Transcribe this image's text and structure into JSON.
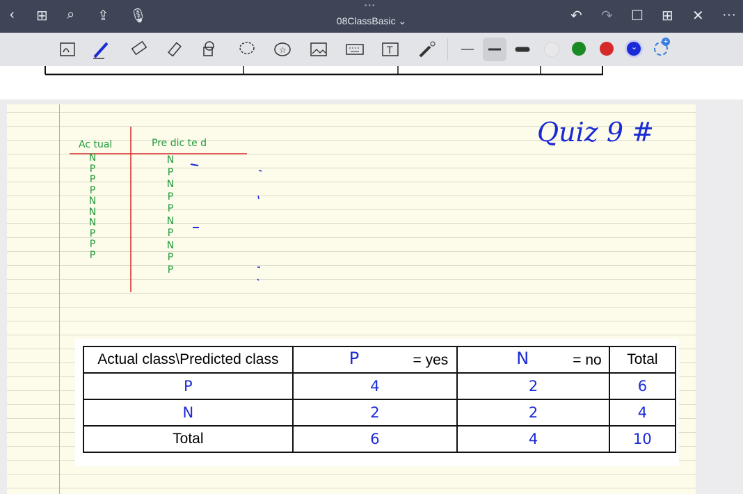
{
  "window": {
    "title": "08ClassBasic ⌄"
  },
  "topbar_icons": {
    "back": "‹",
    "grid": "⊞",
    "search": "⌕",
    "share": "⇪",
    "mic": "🎙",
    "undo": "↶",
    "redo": "↷",
    "bookmark": "☐",
    "add_page": "⊞",
    "close": "✕",
    "more": "···"
  },
  "colors": {
    "accent_blue": "#1a2ad6",
    "green_ink": "#1f9a3a",
    "red_ink": "#d62a2a",
    "swatch_selected": "#1a2ad6"
  },
  "notes": {
    "header_actual": "Ac tual",
    "header_predicted": "Pre dic te d",
    "actual_col": [
      "N",
      "P",
      "P",
      "P",
      "N",
      "N",
      "N",
      "P",
      "P",
      "P"
    ],
    "predicted_col": [
      "N",
      "P",
      "N",
      "P",
      "P",
      "N",
      "P",
      "N",
      "P",
      "P"
    ],
    "quiz_title": "Quiz 9 #"
  },
  "confusion_table": {
    "header": [
      "Actual class\\Predicted class",
      "P",
      "= yes",
      "N",
      "= no",
      "Total"
    ],
    "rows": [
      [
        "P",
        "4",
        "2",
        "6"
      ],
      [
        "N",
        "2",
        "2",
        "4"
      ],
      [
        "Total",
        "6",
        "4",
        "10"
      ]
    ]
  }
}
